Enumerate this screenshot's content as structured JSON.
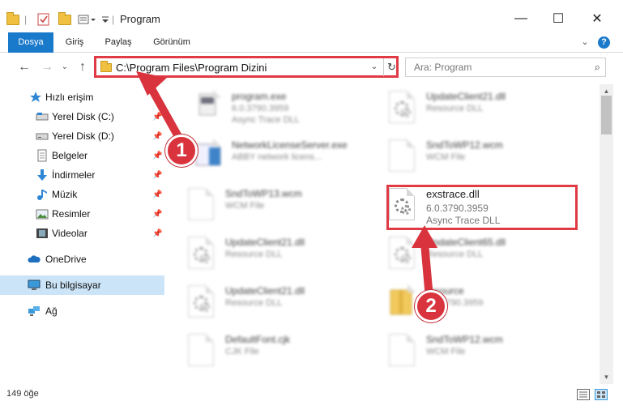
{
  "window": {
    "title": "Program",
    "minimize": "—",
    "maximize": "☐",
    "close": "✕"
  },
  "ribbon": {
    "tabs": [
      "Dosya",
      "Giriş",
      "Paylaş",
      "Görünüm"
    ],
    "collapse": "⌄",
    "help": "?"
  },
  "navbar": {
    "back": "←",
    "forward": "→",
    "recent": "⌄",
    "up": "↑",
    "address": "C:\\Program Files\\Program Dizini",
    "dropdown": "⌄",
    "refresh": "↻",
    "search_placeholder": "Ara: Program",
    "search_icon": "⌕"
  },
  "sidebar": {
    "items": [
      {
        "label": "Hızlı erişim",
        "icon": "star-icon"
      },
      {
        "label": "Yerel Disk (C:)",
        "icon": "drive-icon",
        "pin": "📌"
      },
      {
        "label": "Yerel Disk (D:)",
        "icon": "drive-icon",
        "pin": "📌"
      },
      {
        "label": "Belgeler",
        "icon": "documents-icon",
        "pin": "📌"
      },
      {
        "label": "İndirmeler",
        "icon": "download-icon",
        "pin": "📌"
      },
      {
        "label": "Müzik",
        "icon": "music-icon",
        "pin": "📌"
      },
      {
        "label": "Resimler",
        "icon": "pictures-icon",
        "pin": "📌"
      },
      {
        "label": "Videolar",
        "icon": "videos-icon",
        "pin": "📌"
      },
      {
        "label": "OneDrive",
        "icon": "cloud-icon"
      },
      {
        "label": "Bu bilgisayar",
        "icon": "computer-icon"
      },
      {
        "label": "Ağ",
        "icon": "network-icon"
      }
    ]
  },
  "files": [
    {
      "name": "program.exe",
      "line1": "6.0.3790.3959",
      "line2": "Async Trace DLL"
    },
    {
      "name": "UpdateClient21.dll",
      "line1": "Resource DLL",
      "line2": ""
    },
    {
      "name": "NetworkLicenseServer.exe",
      "line1": "ABBY network licens...",
      "line2": ""
    },
    {
      "name": "SndToWP12.wcm",
      "line1": "WCM File",
      "line2": ""
    },
    {
      "name": "SndToWP13.wcm",
      "line1": "WCM File",
      "line2": ""
    },
    {
      "name": "exstrace.dll",
      "line1": "6.0.3790.3959",
      "line2": "Async Trace DLL"
    },
    {
      "name": "UpdateClient21.dll",
      "line1": "Resource DLL",
      "line2": ""
    },
    {
      "name": "UpdateClient65.dll",
      "line1": "Resource DLL",
      "line2": ""
    },
    {
      "name": "UpdateClient21.dll",
      "line1": "Resource DLL",
      "line2": ""
    },
    {
      "name": "resource",
      "line1": "6.0.3790.3959",
      "line2": ""
    },
    {
      "name": "DefaultFont.cjk",
      "line1": "CJK File",
      "line2": ""
    },
    {
      "name": "SndToWP12.wcm",
      "line1": "WCM File",
      "line2": ""
    }
  ],
  "scrollbar": {
    "up": "▲",
    "down": "▼"
  },
  "status": {
    "count": "149 öğe"
  },
  "annotations": {
    "badge1": "1",
    "badge2": "2"
  },
  "colors": {
    "accent": "#1979ca",
    "highlight": "#e03a45",
    "selected": "#cce4f7"
  }
}
